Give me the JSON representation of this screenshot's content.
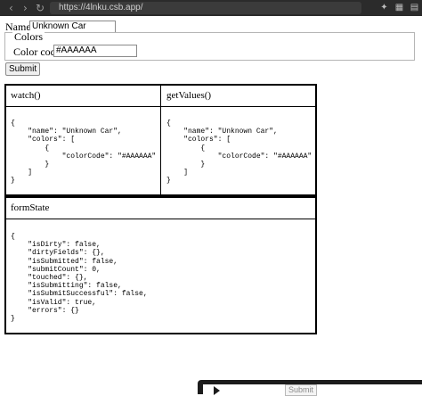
{
  "browser": {
    "url": "https://4lnku.csb.app/",
    "nav_back": "‹",
    "nav_forward": "›",
    "nav_reload": "↻"
  },
  "form": {
    "name_label": "Name:",
    "name_value": "Unknown Car",
    "legend": "Colors",
    "color_code_label": "Color code:",
    "color_code_value": "#AAAAAA",
    "submit_label": "Submit"
  },
  "tables": {
    "watch_header": "watch()",
    "watch_json": "{\n    \"name\": \"Unknown Car\",\n    \"colors\": [\n        {\n            \"colorCode\": \"#AAAAAA\"\n        }\n    ]\n}",
    "getvalues_header": "getValues()",
    "getvalues_json": "{\n    \"name\": \"Unknown Car\",\n    \"colors\": [\n        {\n            \"colorCode\": \"#AAAAAA\"\n        }\n    ]\n}",
    "formstate_header": "formState",
    "formstate_json": "{\n    \"isDirty\": false,\n    \"dirtyFields\": {},\n    \"isSubmitted\": false,\n    \"submitCount\": 0,\n    \"touched\": {},\n    \"isSubmitting\": false,\n    \"isSubmitSuccessful\": false,\n    \"isValid\": true,\n    \"errors\": {}\n}"
  },
  "overlay": {
    "submit_label": "Submit"
  }
}
